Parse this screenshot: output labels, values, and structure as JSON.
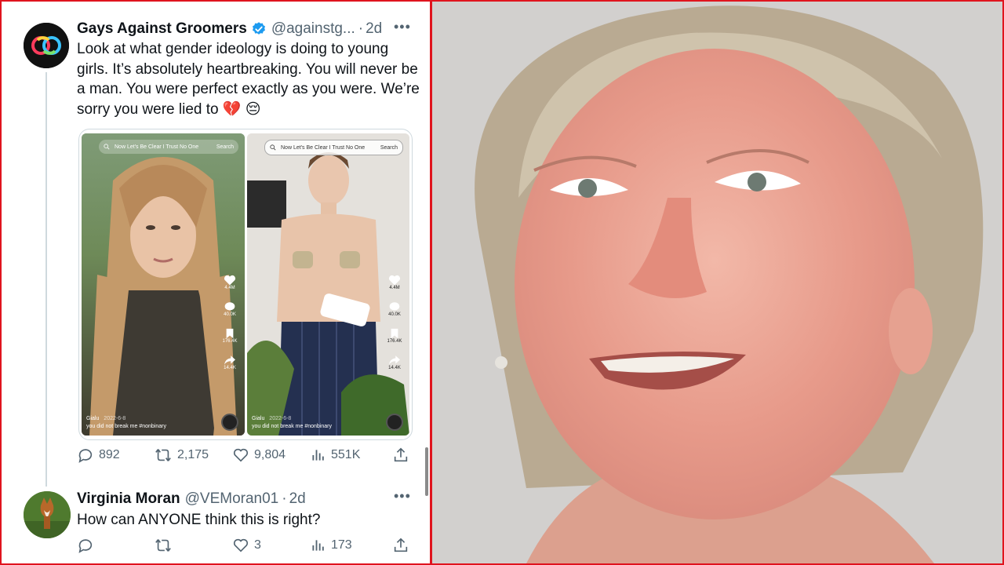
{
  "tweet": {
    "display_name": "Gays Against Groomers",
    "handle": "@againstg...",
    "separator": "·",
    "age": "2d",
    "text": "Look at what gender ideology is doing to young girls. It’s absolutely heartbreaking. You will never be a man. You were perfect exactly as you were. We’re sorry you were lied to 💔 😔",
    "stats": {
      "replies": "892",
      "reposts": "2,175",
      "likes": "9,804",
      "views": "551K"
    }
  },
  "media": {
    "left": {
      "search_text": "Now Let's Be Clear I Trust No One",
      "search_button": "Search",
      "likes": "4.4M",
      "comments": "40.0K",
      "saves": "176.4K",
      "shares": "14.4K",
      "username": "Gialu",
      "date": "2022-6-8",
      "caption": "you did not break me #nonbinary"
    },
    "right": {
      "search_text": "Now Let's Be Clear I Trust No One",
      "search_button": "Search",
      "likes": "4.4M",
      "comments": "40.0K",
      "saves": "176.4K",
      "shares": "14.4K",
      "username": "Gialu",
      "date": "2022-6-8",
      "caption": "you did not break me #nonbinary"
    }
  },
  "reply": {
    "display_name": "Virginia Moran",
    "handle": "@VEMoran01",
    "separator": "·",
    "age": "2d",
    "text": "How can ANYONE think this is right?",
    "stats": {
      "replies": "",
      "reposts": "",
      "likes": "3",
      "views": "173"
    }
  },
  "colors": {
    "verified": "#1d9bf0",
    "frame_red": "#e0141e",
    "muted": "#536471"
  },
  "icons": [
    "verified-badge-icon",
    "reply-icon",
    "repost-icon",
    "like-icon",
    "views-icon",
    "share-icon",
    "more-icon",
    "search-icon",
    "heart-icon",
    "comment-icon",
    "bookmark-icon",
    "share-arrow-icon"
  ]
}
